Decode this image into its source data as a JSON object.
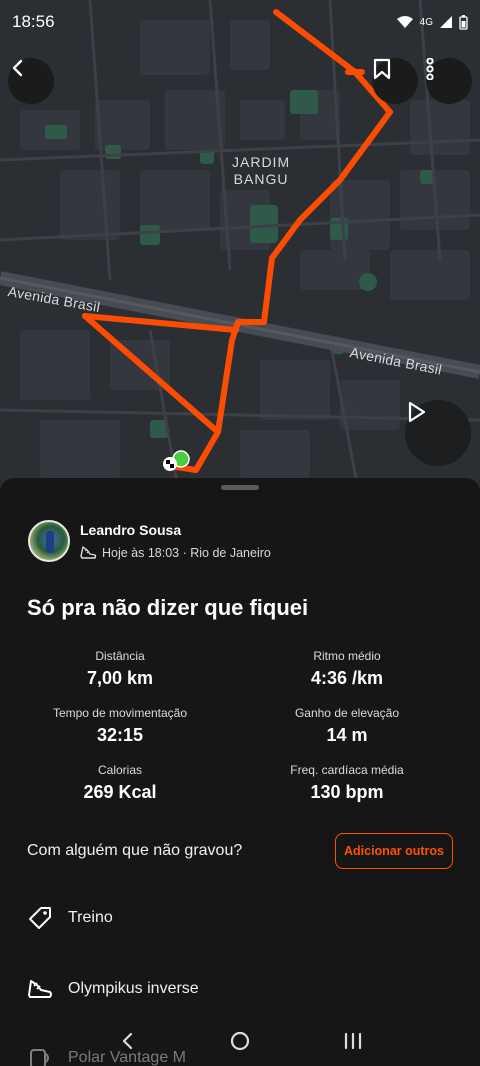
{
  "status_bar": {
    "time": "18:56",
    "network": "4G"
  },
  "map": {
    "neighborhood": "JARDIM\nBANGU",
    "road_label_left": "Avenida Brasil",
    "road_label_right": "Avenida Brasil",
    "route_color": "#fc4c02"
  },
  "athlete": {
    "name": "Leandro Sousa",
    "meta": "Hoje às 18:03 · Rio de Janeiro"
  },
  "activity": {
    "title": "Só pra não dizer que fiquei"
  },
  "stats": [
    {
      "label": "Distância",
      "value": "7,00 km"
    },
    {
      "label": "Ritmo médio",
      "value": "4:36 /km"
    },
    {
      "label": "Tempo de movimentação",
      "value": "32:15"
    },
    {
      "label": "Ganho de elevação",
      "value": "14 m"
    },
    {
      "label": "Calorias",
      "value": "269 Kcal"
    },
    {
      "label": "Freq. cardíaca média",
      "value": "130 bpm"
    }
  ],
  "with_others": {
    "prompt": "Com alguém que não gravou?",
    "button": "Adicionar outros"
  },
  "details": [
    {
      "icon": "tag-icon",
      "label": "Treino"
    },
    {
      "icon": "shoe-icon",
      "label": "Olympikus inverse"
    },
    {
      "icon": "device-icon",
      "label": "Polar Vantage M"
    }
  ],
  "colors": {
    "accent": "#fc5200",
    "background": "#161616"
  }
}
